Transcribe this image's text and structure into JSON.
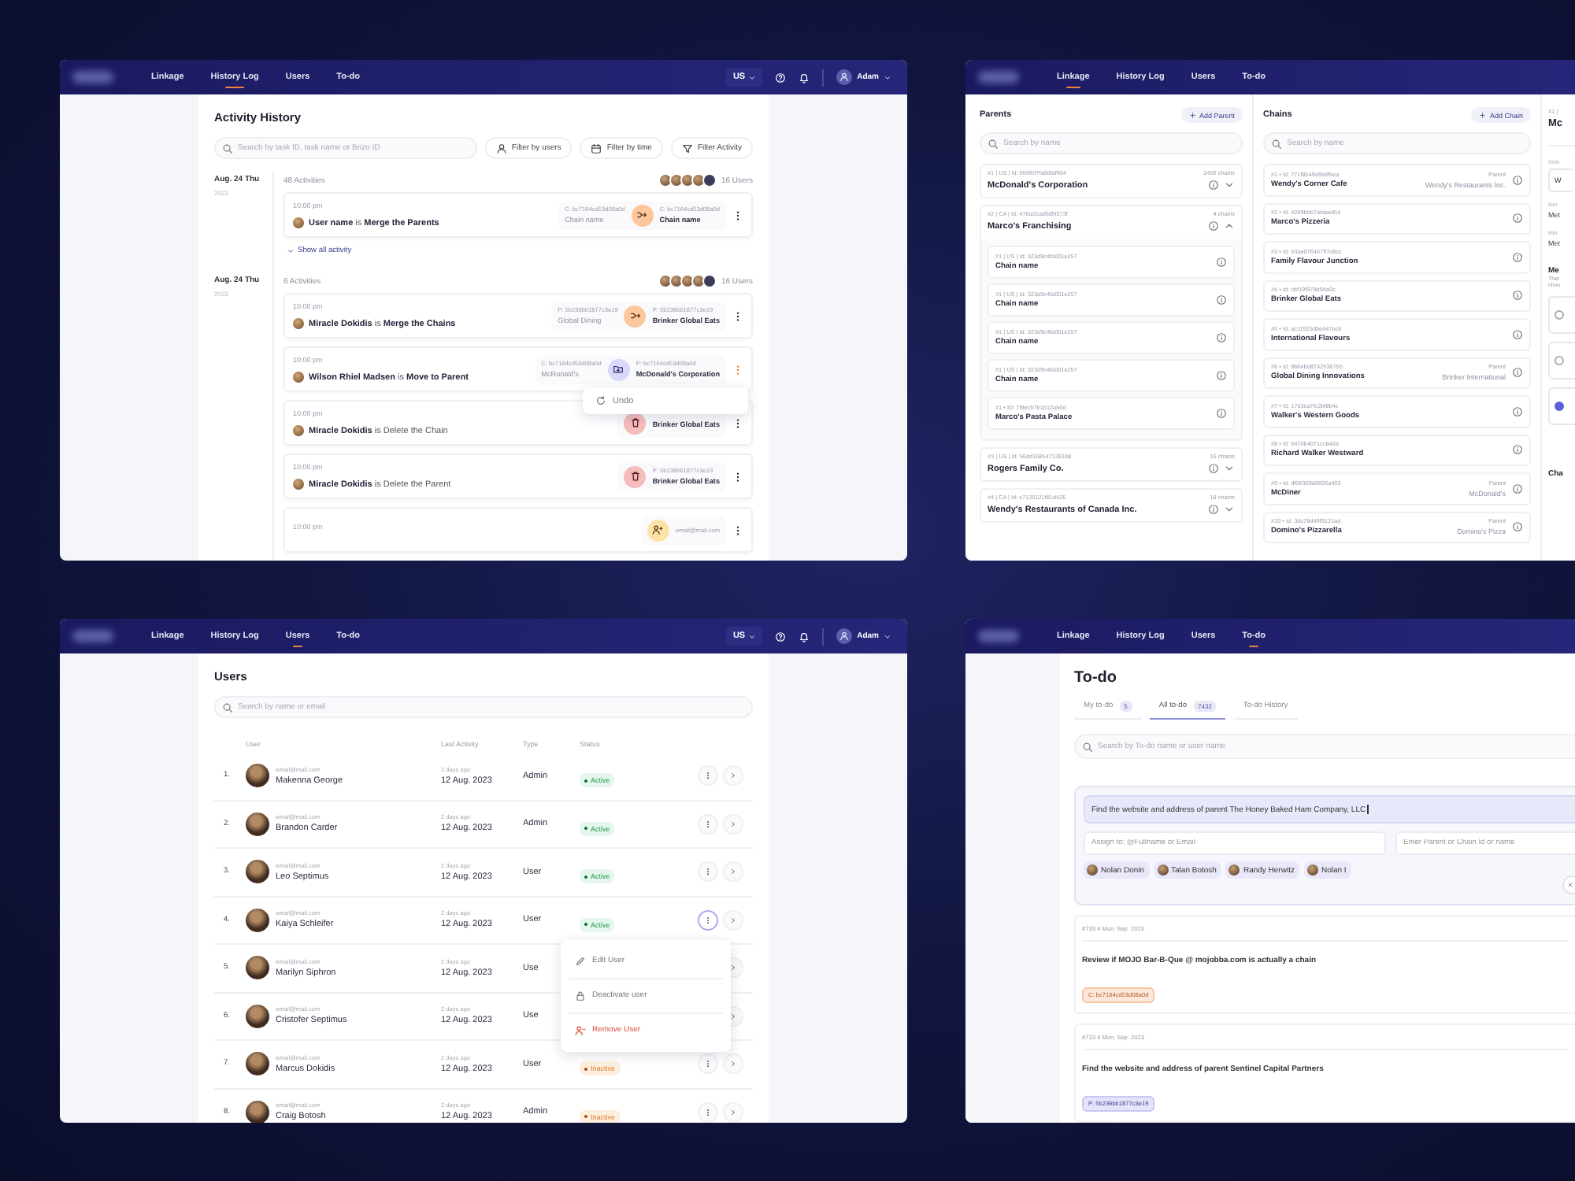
{
  "screens": [
    {
      "kind": "history",
      "nav": {
        "tabs": [
          {
            "label": "Linkage",
            "selected": false
          },
          {
            "label": "History Log",
            "selected": true
          },
          {
            "label": "Users",
            "selected": false
          },
          {
            "label": "To-do",
            "selected": false
          }
        ],
        "region": "US",
        "user": "Adam"
      },
      "title": "Activity History",
      "search": {
        "placeholder": "Search by task ID, task name or Brizo ID"
      },
      "filters": [
        {
          "label": "Filter by users",
          "kind": "user"
        },
        {
          "label": "Filter by time",
          "kind": "time"
        },
        {
          "label": "Filter Activity",
          "kind": "activity"
        }
      ],
      "groups": [
        {
          "date": "Aug. 24 Thu",
          "year": "2023",
          "count": "48 Activities",
          "users": "16 Users",
          "show_all": "Show all activity",
          "items": [
            {
              "kind": "merge",
              "time": "10:00 pm",
              "text": "**User name** is **Merge the Parents**",
              "from": {
                "id": "C: bc7164cd53d08a0d",
                "name": "Chain name"
              },
              "to": {
                "id": "C: bc7164cd53d08a0d",
                "name": "Chain name"
              },
              "menu_open": false
            }
          ]
        },
        {
          "date": "Aug. 24 Thu",
          "year": "2023",
          "count": "6 Activities",
          "users": "16 Users",
          "items": [
            {
              "kind": "merge",
              "time": "10:00 pm",
              "text": "**Miracle Dokidis** is **Merge the Chains**",
              "from": {
                "id": "P: 5b236bb1877c3e19",
                "name": "Global Dining"
              },
              "to": {
                "id": "P: 5b236bb1877c3e19",
                "name": "Brinker Global Eats"
              },
              "menu_open": false
            },
            {
              "kind": "move",
              "time": "10:00 pm",
              "text": "**Wilson Rhiel Madsen** is **Move to Parent**",
              "from": {
                "id": "C: bc7164cd53d08a0d",
                "name": "McRonald's"
              },
              "to": {
                "id": "P: bc7164cd53d08a0d",
                "name": "McDonald's Corporation"
              },
              "menu_open": true,
              "menu": {
                "label": "Undo"
              }
            },
            {
              "kind": "delete",
              "time": "10:00 pm",
              "text": "**Miracle Dokidis** is Delete the Chain",
              "to": {
                "name": "Brinker Global Eats"
              },
              "menu_open": false
            },
            {
              "kind": "delete",
              "time": "10:00 pm",
              "text": "**Miracle Dokidis** is Delete the Parent",
              "to": {
                "id": "P: 5b236bb1877c3e19",
                "name": "Brinker Global Eats"
              },
              "menu_open": false
            },
            {
              "kind": "user",
              "time": "10:00 pm",
              "to": {
                "id": "email@mail.com"
              },
              "menu_open": false
            }
          ]
        }
      ]
    },
    {
      "kind": "linkage",
      "nav": {
        "tabs": [
          {
            "label": "Linkage",
            "selected": true
          },
          {
            "label": "History Log",
            "selected": false
          },
          {
            "label": "Users",
            "selected": false
          },
          {
            "label": "To-do",
            "selected": false
          }
        ]
      },
      "parents": {
        "title": "Parents",
        "add": "Add Parent",
        "placeholder": "Search by name",
        "items": [
          {
            "meta": "#1 | US | Id: 656f5f7fa8dfaf654",
            "name": "McDonald's Corporation",
            "count": "2456 chains",
            "expanded": false
          },
          {
            "meta": "#2 | CA | Id: 476a01ad6d5f273f",
            "name": "Marco's Franchising",
            "count": "4 chains",
            "expanded": true,
            "children": [
              {
                "meta": "#1 | US | Id: 323d9c4fa001e257",
                "name": "Chain name"
              },
              {
                "meta": "#1 | US | Id: 323d9c4fa001e257",
                "name": "Chain name"
              },
              {
                "meta": "#1 | US | Id: 323d9c4fa001e257",
                "name": "Chain name"
              },
              {
                "meta": "#1 | US | Id: 323d9c4fa001e257",
                "name": "Chain name"
              },
              {
                "meta": "#1 • ID: 79fec57b1b12ab6d",
                "name": "Marco's Pasta Palace"
              }
            ]
          },
          {
            "meta": "#3 | US | Id: 56dd1685471381b8",
            "name": "Rogers Family Co.",
            "count": "16 chains",
            "expanded": false
          },
          {
            "meta": "#4 | CA | Id: c7120121f81d426",
            "name": "Wendy's Restaurants of Canada Inc.",
            "count": "18 chains",
            "expanded": false
          }
        ]
      },
      "chains": {
        "title": "Chains",
        "add": "Add Chain",
        "placeholder": "Search by name",
        "items": [
          {
            "meta": "#1 • Id: 771f8549c6bdf5ea",
            "name": "Wendy's Corner Cafe",
            "parent_label": "Parent",
            "parent": "Wendy's Restaurants Inc."
          },
          {
            "meta": "#2 • Id: 4289bb67aldaed54",
            "name": "Marco's Pizzeria"
          },
          {
            "meta": "#3 • Id: 53ae07646797c8cc",
            "name": "Family Flavour Junction"
          },
          {
            "meta": "#4 • Id: cbf19f979d94a0c",
            "name": "Brinker Global Eats"
          },
          {
            "meta": "#5 • Id: ac11923dbe647ocb",
            "name": "International Flavours"
          },
          {
            "meta": "#6 • Id: 966ebd8742536750",
            "name": "Global Dining Innovations",
            "parent_label": "Parent",
            "parent": "Brinker International"
          },
          {
            "meta": "#7 • Id: 17d3ca7fc2bf8b4c",
            "name": "Walker's Western Goods"
          },
          {
            "meta": "#8 • Id: 5470b4071cc840a",
            "name": "Richard Walker Westward"
          },
          {
            "meta": "#9 • Id: df06309d0605a403",
            "name": "McDiner",
            "parent_label": "Parent",
            "parent": "McDonald's"
          },
          {
            "meta": "#10 • Id: 3dc78d49f9121ad",
            "name": "Domino's Pizzarella",
            "parent_label": "Parent",
            "parent": "Domino's Pizza"
          }
        ]
      },
      "detail": {
        "meta": "#1 |",
        "title": "Mc",
        "fields": [
          {
            "label": "Web",
            "value": "W",
            "kind": "input"
          },
          {
            "label": "Met",
            "value": "Met",
            "kind": "text"
          },
          {
            "label": "Met",
            "value": "Met",
            "kind": "text"
          }
        ],
        "section": "Me",
        "note": [
          "Ther",
          "choo"
        ],
        "options": [
          {
            "selected": false
          },
          {
            "selected": false
          },
          {
            "selected": true
          }
        ],
        "section_2": "Cha"
      }
    },
    {
      "kind": "users",
      "nav": {
        "tabs": [
          {
            "label": "Linkage",
            "selected": false
          },
          {
            "label": "History Log",
            "selected": false
          },
          {
            "label": "Users",
            "selected": true
          },
          {
            "label": "To-do",
            "selected": false
          }
        ],
        "region": "US",
        "user": "Adam"
      },
      "title": "Users",
      "search": {
        "placeholder": "Search by name or email"
      },
      "columns": [
        "User",
        "Last Activity",
        "Type",
        "Status"
      ],
      "rows": [
        {
          "num": "1.",
          "email": "email@mail.com",
          "name": "Makenna George",
          "ago": "2 days ago",
          "date": "12 Aug. 2023",
          "type": "Admin",
          "status": {
            "label": "Active",
            "kind": "active"
          },
          "more_button": true,
          "menu_open": false
        },
        {
          "num": "2.",
          "email": "email@mail.com",
          "name": "Brandon Carder",
          "ago": "2 days ago",
          "date": "12 Aug. 2023",
          "type": "Admin",
          "status": {
            "label": "Active",
            "kind": "active"
          },
          "more_button": true,
          "menu_open": false
        },
        {
          "num": "3.",
          "email": "email@mail.com",
          "name": "Leo Septimus",
          "ago": "2 days ago",
          "date": "12 Aug. 2023",
          "type": "User",
          "status": {
            "label": "Active",
            "kind": "active"
          },
          "more_button": true,
          "menu_open": false
        },
        {
          "num": "4.",
          "email": "email@mail.com",
          "name": "Kaiya Schleifer",
          "ago": "2 days ago",
          "date": "12 Aug. 2023",
          "type": "User",
          "status": {
            "label": "Active",
            "kind": "active"
          },
          "more_button": true,
          "menu_open": true
        },
        {
          "num": "5.",
          "email": "email@mail.com",
          "name": "Marilyn Siphron",
          "ago": "2 days ago",
          "date": "12 Aug. 2023",
          "type": "Use",
          "more_button": false,
          "menu_open": false
        },
        {
          "num": "6.",
          "email": "email@mail.com",
          "name": "Cristofer Septimus",
          "ago": "2 days ago",
          "date": "12 Aug. 2023",
          "type": "Use",
          "more_button": false,
          "menu_open": false
        },
        {
          "num": "7.",
          "email": "email@mail.com",
          "name": "Marcus Dokidis",
          "ago": "2 days ago",
          "date": "12 Aug. 2023",
          "type": "User",
          "status": {
            "label": "Inactive",
            "kind": "inactive"
          },
          "more_button": true,
          "menu_open": false
        },
        {
          "num": "8.",
          "email": "email@mail.com",
          "name": "Craig Botosh",
          "ago": "2 days ago",
          "date": "12 Aug. 2023",
          "type": "Admin",
          "status": {
            "label": "Inactive",
            "kind": "inactive"
          },
          "more_button": true,
          "menu_open": false
        }
      ],
      "row_menu": [
        {
          "label": "Edit User",
          "kind": "edit"
        },
        {
          "label": "Deactivate user",
          "kind": "deactivate"
        },
        {
          "label": "Remove User",
          "kind": "remove"
        }
      ]
    },
    {
      "kind": "todo",
      "nav": {
        "tabs": [
          {
            "label": "Linkage",
            "selected": false
          },
          {
            "label": "History Log",
            "selected": false
          },
          {
            "label": "Users",
            "selected": false
          },
          {
            "label": "To-do",
            "selected": true
          }
        ]
      },
      "title": "To-do",
      "tabs": [
        {
          "label": "My to-do",
          "count": "5",
          "selected": false
        },
        {
          "label": "All to-do",
          "count": "7432",
          "selected": true
        },
        {
          "label": "To-do History",
          "selected": false
        }
      ],
      "search": {
        "placeholder": "Search by To-do name or user name"
      },
      "composer": {
        "value": "Find the website and address of parent The Honey Baked Ham Company, LLC",
        "assign_placeholder": "Assign to: @Fullname or Email",
        "target_placeholder": "Enter Parent or Chain Id or name",
        "assignees": [
          "Nolan Donin",
          "Talan Botosh",
          "Randy Herwitz",
          "Nolan I"
        ]
      },
      "tasks": [
        {
          "meta": "#733  4 Mon. Sep. 2023",
          "title": "Review if MOJO Bar-B-Que @ mojobba.com is actually a chain",
          "tag": "C: bc7164cd53d08a0d",
          "kind": "chain"
        },
        {
          "meta": "#733  4 Mon. Sep. 2023",
          "title": "Find the website and address of parent Sentinel Capital Partners",
          "tag": "P: 5b236bb1877c3e19",
          "kind": "parent"
        }
      ]
    }
  ]
}
